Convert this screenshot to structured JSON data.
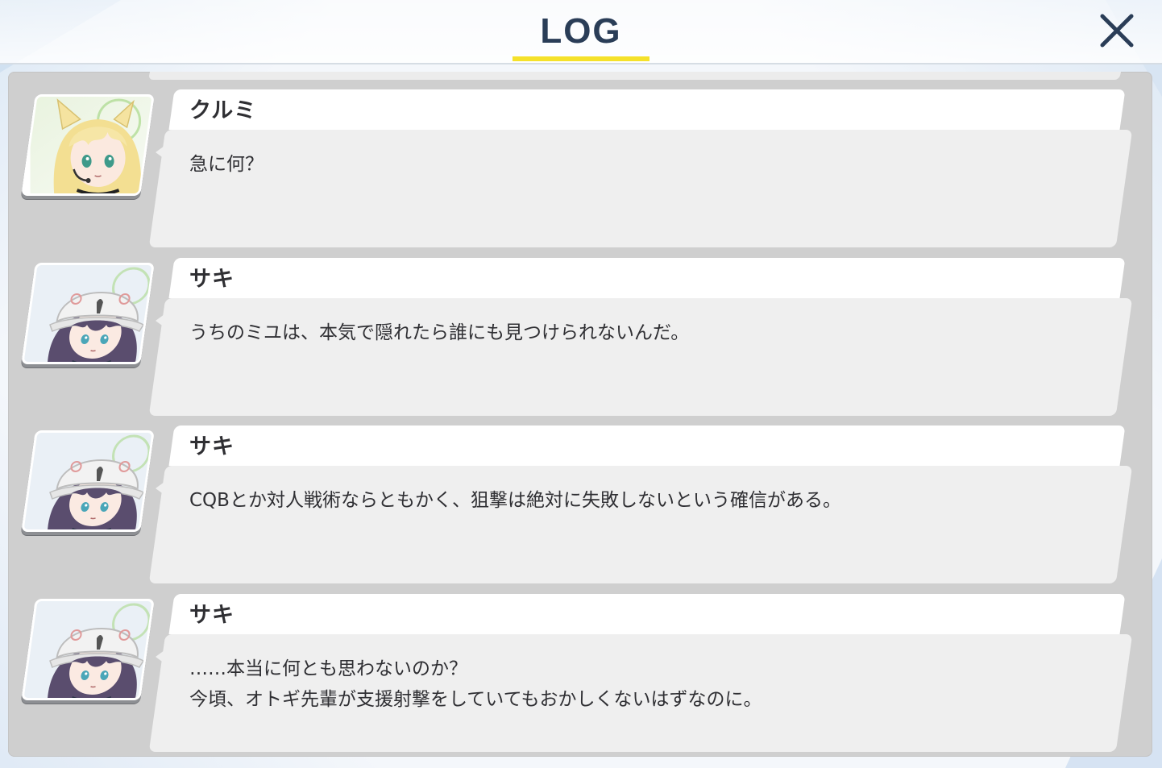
{
  "header": {
    "title": "LOG",
    "close_icon": "close-icon"
  },
  "entries": [
    {
      "speaker": "クルミ",
      "portrait": "kurumi-portrait",
      "lines": [
        "急に何？"
      ]
    },
    {
      "speaker": "サキ",
      "portrait": "saki-portrait",
      "lines": [
        "うちのミユは、本気で隠れたら誰にも見つけられないんだ。"
      ]
    },
    {
      "speaker": "サキ",
      "portrait": "saki-portrait",
      "lines": [
        "CQBとか対人戦術ならともかく、狙撃は絶対に失敗しないという確信がある。"
      ]
    },
    {
      "speaker": "サキ",
      "portrait": "saki-portrait",
      "lines": [
        "……本当に何とも思わないのか？",
        "今頃、オトギ先輩が支援射撃をしていてもおかしくないはずなのに。"
      ]
    }
  ],
  "colors": {
    "title_text": "#2a3d57",
    "title_underline": "#f5e12a",
    "panel": "#cfcfcf",
    "bubble": "#efefef",
    "name_bar": "#ffffff",
    "text": "#2f2f33"
  }
}
